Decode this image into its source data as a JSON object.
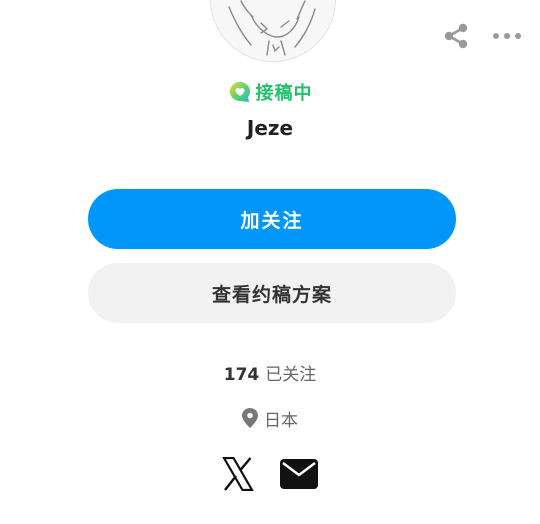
{
  "profile": {
    "status_label": "接稿中",
    "username": "Jeze",
    "following_count": "174",
    "following_label": "已关注",
    "location": "日本"
  },
  "actions": {
    "follow_label": "加关注",
    "view_plans_label": "查看约稿方案"
  },
  "icons": {
    "share": "share-icon",
    "more": "more-options-icon",
    "status": "chat-bubble-heart-icon",
    "location": "location-pin-icon",
    "social_x": "x-logo-icon",
    "mail": "mail-icon"
  },
  "colors": {
    "accent": "#0096fa",
    "status_green": "#21c16b",
    "secondary_button": "#f2f2f2"
  }
}
